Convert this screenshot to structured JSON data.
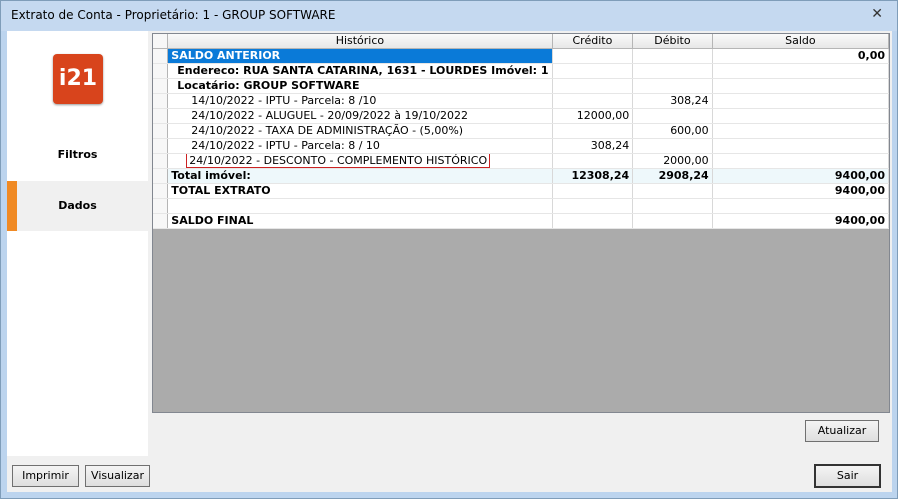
{
  "window": {
    "title": "Extrato de Conta - Proprietário:  1 - GROUP SOFTWARE",
    "close": "✕"
  },
  "sidebar": {
    "logo": "i21",
    "filtros": "Filtros",
    "dados": "Dados"
  },
  "grid": {
    "headers": {
      "historico": "Histórico",
      "credito": "Crédito",
      "debito": "Débito",
      "saldo": "Saldo"
    },
    "rows": [
      {
        "hist": "SALDO ANTERIOR",
        "cred": "",
        "deb": "",
        "saldo": "0,00"
      },
      {
        "hist": "Endereco: RUA SANTA CATARINA, 1631 - LOURDES     Imóvel: 1",
        "cred": "",
        "deb": "",
        "saldo": ""
      },
      {
        "hist": "Locatário: GROUP SOFTWARE",
        "cred": "",
        "deb": "",
        "saldo": ""
      },
      {
        "hist": "14/10/2022 - IPTU - Parcela: 8 /10",
        "cred": "",
        "deb": "308,24",
        "saldo": ""
      },
      {
        "hist": "24/10/2022 - ALUGUEL - 20/09/2022 à 19/10/2022",
        "cred": "12000,00",
        "deb": "",
        "saldo": ""
      },
      {
        "hist": "24/10/2022 - TAXA DE ADMINISTRAÇÃO - (5,00%)",
        "cred": "",
        "deb": "600,00",
        "saldo": ""
      },
      {
        "hist": "24/10/2022 - IPTU - Parcela: 8  / 10",
        "cred": "308,24",
        "deb": "",
        "saldo": ""
      },
      {
        "hist": "24/10/2022 - DESCONTO  - COMPLEMENTO HISTÓRICO",
        "cred": "",
        "deb": "2000,00",
        "saldo": ""
      },
      {
        "hist": "Total imóvel:",
        "cred": "12308,24",
        "deb": "2908,24",
        "saldo": "9400,00"
      },
      {
        "hist": "TOTAL EXTRATO",
        "cred": "",
        "deb": "",
        "saldo": "9400,00"
      },
      {
        "hist": "",
        "cred": "",
        "deb": "",
        "saldo": ""
      },
      {
        "hist": "SALDO FINAL",
        "cred": "",
        "deb": "",
        "saldo": "9400,00"
      }
    ]
  },
  "buttons": {
    "atualizar": "Atualizar",
    "imprimir": "Imprimir",
    "visualizar": "Visualizar",
    "sair": "Sair"
  }
}
